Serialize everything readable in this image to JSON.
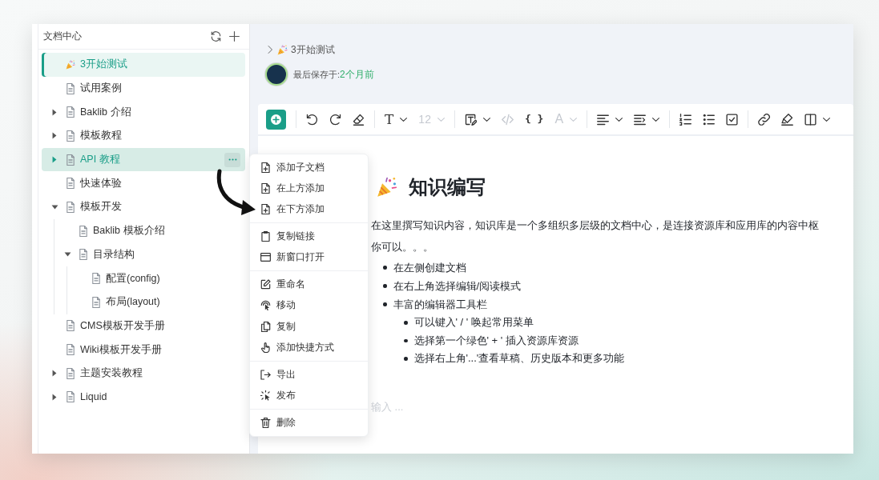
{
  "sidebar": {
    "title": "文档中心",
    "tree": [
      {
        "label": "3开始测试",
        "kind": "emoji",
        "selected": true,
        "highlighted": false
      },
      {
        "label": "试用案例",
        "kind": "doc",
        "selected": false,
        "highlighted": false
      },
      {
        "label": "Baklib 介绍",
        "kind": "doc",
        "expanded": false,
        "selected": false,
        "highlighted": false
      },
      {
        "label": "模板教程",
        "kind": "doc",
        "expanded": false,
        "selected": false,
        "highlighted": false
      },
      {
        "label": "API 教程",
        "kind": "doc",
        "expanded": false,
        "selected": false,
        "highlighted": true
      },
      {
        "label": "快速体验",
        "kind": "doc",
        "selected": false,
        "highlighted": false
      },
      {
        "label": "模板开发",
        "kind": "doc",
        "expanded": true,
        "selected": false,
        "highlighted": false,
        "children": [
          {
            "label": "Baklib 模板介绍",
            "kind": "doc",
            "selected": false,
            "highlighted": false
          },
          {
            "label": "目录结构",
            "kind": "doc",
            "expanded": true,
            "selected": false,
            "highlighted": false,
            "children": [
              {
                "label": "配置(config)",
                "kind": "doc",
                "selected": false,
                "highlighted": false
              },
              {
                "label": "布局(layout)",
                "kind": "doc",
                "selected": false,
                "highlighted": false
              }
            ]
          }
        ]
      },
      {
        "label": "CMS模板开发手册",
        "kind": "doc",
        "selected": false,
        "highlighted": false
      },
      {
        "label": "Wiki模板开发手册",
        "kind": "doc",
        "selected": false,
        "highlighted": false
      },
      {
        "label": "主题安装教程",
        "kind": "doc",
        "expanded": false,
        "selected": false,
        "highlighted": false
      },
      {
        "label": "Liquid",
        "kind": "doc",
        "expanded": false,
        "selected": false,
        "highlighted": false
      }
    ]
  },
  "breadcrumb": [
    {
      "label": "3开始测试",
      "kind": "emoji"
    }
  ],
  "save_status": {
    "label": "最后保存于:",
    "time": "2个月前"
  },
  "toolbar": {
    "groups": [
      [
        {
          "kind": "insert",
          "disabled": false
        }
      ],
      [
        {
          "kind": "undo",
          "disabled": false
        },
        {
          "kind": "redo",
          "disabled": false
        },
        {
          "kind": "eraser",
          "disabled": false
        }
      ],
      [
        {
          "kind": "heading",
          "label": "T",
          "disabled": false,
          "dropdown": true
        },
        {
          "kind": "font-size",
          "label": "12",
          "disabled": true,
          "dropdown": true
        }
      ],
      [
        {
          "kind": "format",
          "disabled": false,
          "dropdown": true
        },
        {
          "kind": "code",
          "disabled": true
        },
        {
          "kind": "braces",
          "label": "{ }",
          "disabled": false
        },
        {
          "kind": "font-color",
          "label": "A",
          "disabled": true,
          "dropdown": true
        }
      ],
      [
        {
          "kind": "align",
          "disabled": false,
          "dropdown": true
        },
        {
          "kind": "indent",
          "disabled": false,
          "dropdown": true
        }
      ],
      [
        {
          "kind": "ordered-list",
          "disabled": false
        },
        {
          "kind": "bullet-list",
          "disabled": false
        },
        {
          "kind": "checklist",
          "disabled": false
        }
      ],
      [
        {
          "kind": "link",
          "disabled": false
        },
        {
          "kind": "highlight",
          "disabled": false
        },
        {
          "kind": "columns",
          "disabled": false,
          "dropdown": true
        }
      ]
    ]
  },
  "document": {
    "title": "知识编写",
    "paragraphs": [
      "在这里撰写知识内容，知识库是一个多组织多层级的文档中心，是连接资源库和应用库的内容中枢",
      "你可以。。。"
    ],
    "bullets": [
      {
        "text": "在左侧创建文档"
      },
      {
        "text": "在右上角选择编辑/阅读模式"
      },
      {
        "text": "丰富的编辑器工具栏",
        "children": [
          {
            "text": "可以键入' / ' 唤起常用菜单"
          },
          {
            "text": "选择第一个绿色' + ' 插入资源库资源"
          },
          {
            "text": "选择右上角'...'查看草稿、历史版本和更多功能"
          }
        ]
      }
    ],
    "placeholder": "输入 ..."
  },
  "context_menu": {
    "groups": [
      {
        "items": [
          {
            "label": "添加子文档",
            "kind": "add-child"
          },
          {
            "label": "在上方添加",
            "kind": "add-above"
          },
          {
            "label": "在下方添加",
            "kind": "add-below"
          }
        ]
      },
      {
        "items": [
          {
            "label": "复制链接",
            "kind": "copy-link"
          },
          {
            "label": "新窗口打开",
            "kind": "open-window"
          }
        ]
      },
      {
        "items": [
          {
            "label": "重命名",
            "kind": "rename"
          },
          {
            "label": "移动",
            "kind": "move"
          },
          {
            "label": "复制",
            "kind": "duplicate"
          },
          {
            "label": "添加快捷方式",
            "kind": "shortcut"
          }
        ]
      },
      {
        "items": [
          {
            "label": "导出",
            "kind": "export"
          },
          {
            "label": "发布",
            "kind": "publish"
          }
        ]
      },
      {
        "items": [
          {
            "label": "删除",
            "kind": "delete"
          }
        ]
      }
    ]
  }
}
